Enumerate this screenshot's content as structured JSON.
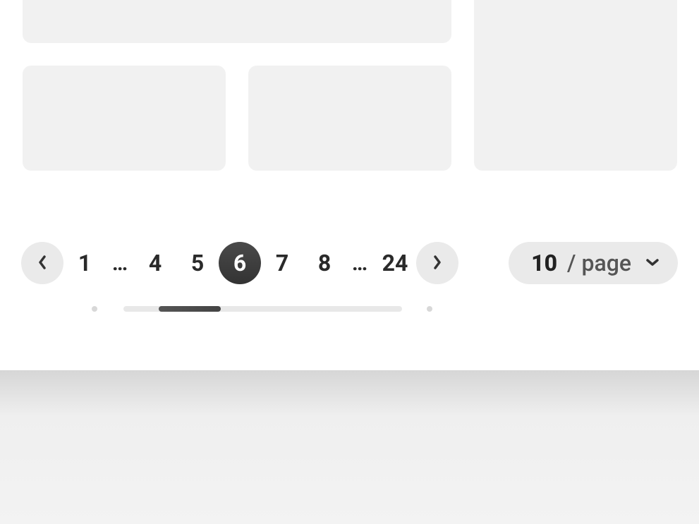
{
  "pagination": {
    "pages": [
      "1",
      "…",
      "4",
      "5",
      "6",
      "7",
      "8",
      "…",
      "24"
    ],
    "active_index": 4,
    "prev_label": "Previous",
    "next_label": "Next"
  },
  "per_page": {
    "count": "10",
    "label": "/ page"
  }
}
